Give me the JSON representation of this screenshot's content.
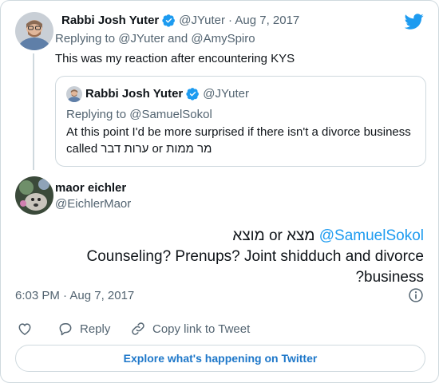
{
  "colors": {
    "accent": "#1d9bf0",
    "text": "#0f1419",
    "muted": "#536471",
    "border": "#cfd9de"
  },
  "tweet1": {
    "name": "Rabbi Josh Yuter",
    "handle": "@JYuter",
    "date": "· Aug 7, 2017",
    "replying_prefix": "Replying to ",
    "replying_to_1": "@JYuter",
    "replying_and": " and ",
    "replying_to_2": "@AmySpiro",
    "text": "This was my reaction after encountering KYS",
    "icons": {
      "verified": "verified-badge-icon",
      "brand": "twitter-bird-icon"
    }
  },
  "quote": {
    "name": "Rabbi Josh Yuter",
    "handle": "@JYuter",
    "replying_prefix": "Replying to ",
    "replying_to": "@SamuelSokol",
    "text_line1": "At this point I'd be more surprised if there isn't a divorce business",
    "text_line2": "called ערות דבר or מר ממות"
  },
  "tweet2": {
    "name": "maor eichler",
    "handle": "@EichlerMaor",
    "mention": "@SamuelSokol",
    "line1_rest": " מוצא or מצא",
    "line2": "Counseling? Prenups? Joint shidduch and divorce",
    "line3": "?business",
    "timestamp": "6:03 PM · Aug 7, 2017",
    "icons": {
      "info": "info-icon"
    }
  },
  "actions": {
    "like_icon": "heart-icon",
    "reply_label": "Reply",
    "reply_icon": "reply-bubble-icon",
    "copy_label": "Copy link to Tweet",
    "copy_icon": "link-icon"
  },
  "explore_label": "Explore what's happening on Twitter"
}
